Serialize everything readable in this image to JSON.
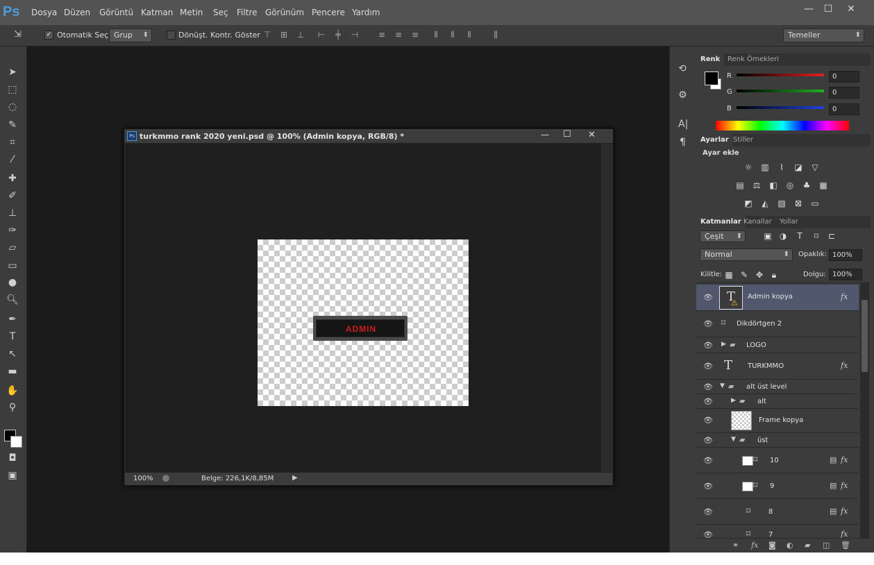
{
  "app": {
    "logo": "Ps"
  },
  "menu": [
    "Dosya",
    "Düzen",
    "Görüntü",
    "Katman",
    "Metin",
    "Seç",
    "Filtre",
    "Görünüm",
    "Pencere",
    "Yardım"
  ],
  "window_controls": {
    "minimize": "—",
    "maximize": "☐",
    "close": "✕"
  },
  "options": {
    "auto_select_label": "Otomatik Seç:",
    "auto_select_value": "Grup",
    "transform_label": "Dönüşt. Kontr. Göster",
    "workspace": "Temeller"
  },
  "document": {
    "title": "turkmmo rank 2020 yeni.psd @ 100% (Admin kopya, RGB/8) *",
    "zoom": "100%",
    "doc_info": "Belge: 226,1K/8,85M",
    "canvas_text": "ADMIN"
  },
  "color_panel": {
    "tabs": [
      "Renk",
      "Renk Örnekleri"
    ],
    "channels": [
      {
        "label": "R",
        "value": "0",
        "color": "#e02020"
      },
      {
        "label": "G",
        "value": "0",
        "color": "#20b020"
      },
      {
        "label": "B",
        "value": "0",
        "color": "#2040e0"
      }
    ]
  },
  "adjust_panel": {
    "tabs": [
      "Ayarlar",
      "Stiller"
    ],
    "heading": "Ayar ekle"
  },
  "layers_panel": {
    "tabs": [
      "Katmanlar",
      "Kanallar",
      "Yollar"
    ],
    "filter_kind": "Çeşit",
    "blend_mode": "Normal",
    "opacity_label": "Opaklık:",
    "opacity_value": "100%",
    "lock_label": "Kilitle:",
    "fill_label": "Dolgu:",
    "fill_value": "100%",
    "layers": [
      {
        "name": "Admin kopya",
        "kind": "text",
        "fx": true,
        "selected": true
      },
      {
        "name": "Dikdörtgen 2",
        "kind": "shape",
        "fx": false
      },
      {
        "name": "LOGO",
        "kind": "group",
        "fx": false
      },
      {
        "name": "TURKMMO",
        "kind": "text",
        "fx": true
      },
      {
        "name": "alt üst level",
        "kind": "group-open",
        "fx": false
      },
      {
        "name": "alt",
        "kind": "group",
        "fx": false
      },
      {
        "name": "Frame kopya",
        "kind": "pixel",
        "fx": false
      },
      {
        "name": "üst",
        "kind": "group-open",
        "fx": false
      },
      {
        "name": "10",
        "kind": "shape-thumb",
        "fx": true
      },
      {
        "name": "9",
        "kind": "shape-thumb",
        "fx": true
      },
      {
        "name": "8",
        "kind": "shape",
        "fx": true
      },
      {
        "name": "7",
        "kind": "shape",
        "fx": true
      }
    ],
    "footer_fx": "fx"
  },
  "icons": {
    "eye": "eye-icon",
    "fx": "effects-icon",
    "text_layer": "T"
  }
}
